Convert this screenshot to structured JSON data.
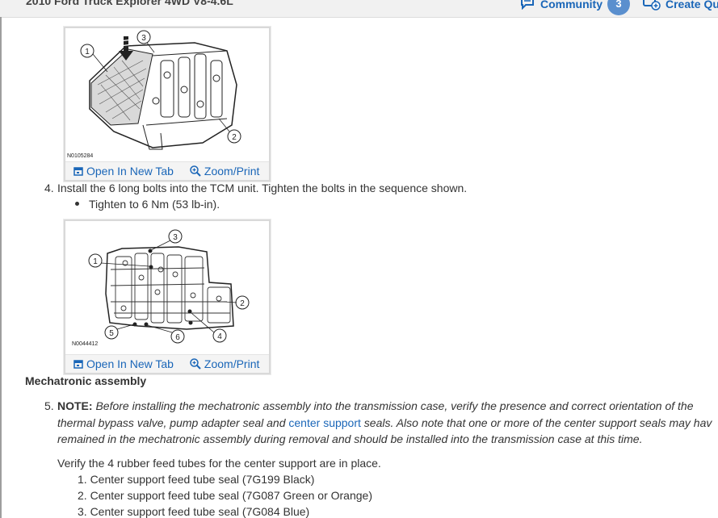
{
  "header": {
    "vehicle_title": "2010 Ford Truck Explorer 4WD V8-4.6L",
    "community_label": "Community",
    "community_count": "3",
    "create_label": "Create Qu"
  },
  "figures": [
    {
      "id_label": "N0105284",
      "callouts": [
        "1",
        "2",
        "3"
      ],
      "open_tab": "Open In New Tab",
      "zoom": "Zoom/Print"
    },
    {
      "id_label": "N0044412",
      "callouts": [
        "1",
        "2",
        "3",
        "4",
        "5",
        "6"
      ],
      "open_tab": "Open In New Tab",
      "zoom": "Zoom/Print"
    }
  ],
  "step4": {
    "number": "4.",
    "text": "Install the 6 long bolts into the TCM unit. Tighten the bolts in the sequence shown.",
    "bullet": "Tighten to 6 Nm (53 lb-in)."
  },
  "section_heading": "Mechatronic assembly",
  "step5": {
    "number": "5.",
    "note_label": "NOTE:",
    "line1": " Before installing the mechatronic assembly into the transmission case, verify the presence and correct orientation of the",
    "line2_pre": "thermal bypass valve, pump adapter seal and ",
    "line2_link": "center support",
    "line2_post": " seals. Also note that one or more of the center support seals may hav",
    "line3": "remained in the mechatronic assembly during removal and should be installed into the transmission case at this time.",
    "verify": "Verify the 4 rubber feed tubes for the center support are in place.",
    "items": [
      "1. Center support feed tube seal (7G199 Black)",
      "2. Center support feed tube seal (7G087 Green or Orange)",
      "3. Center support feed tube seal (7G084 Blue)"
    ]
  },
  "colors": {
    "link": "#1a66b8",
    "badge": "#5a8fce",
    "text": "#333333",
    "topbar": "#f1f1f1"
  }
}
